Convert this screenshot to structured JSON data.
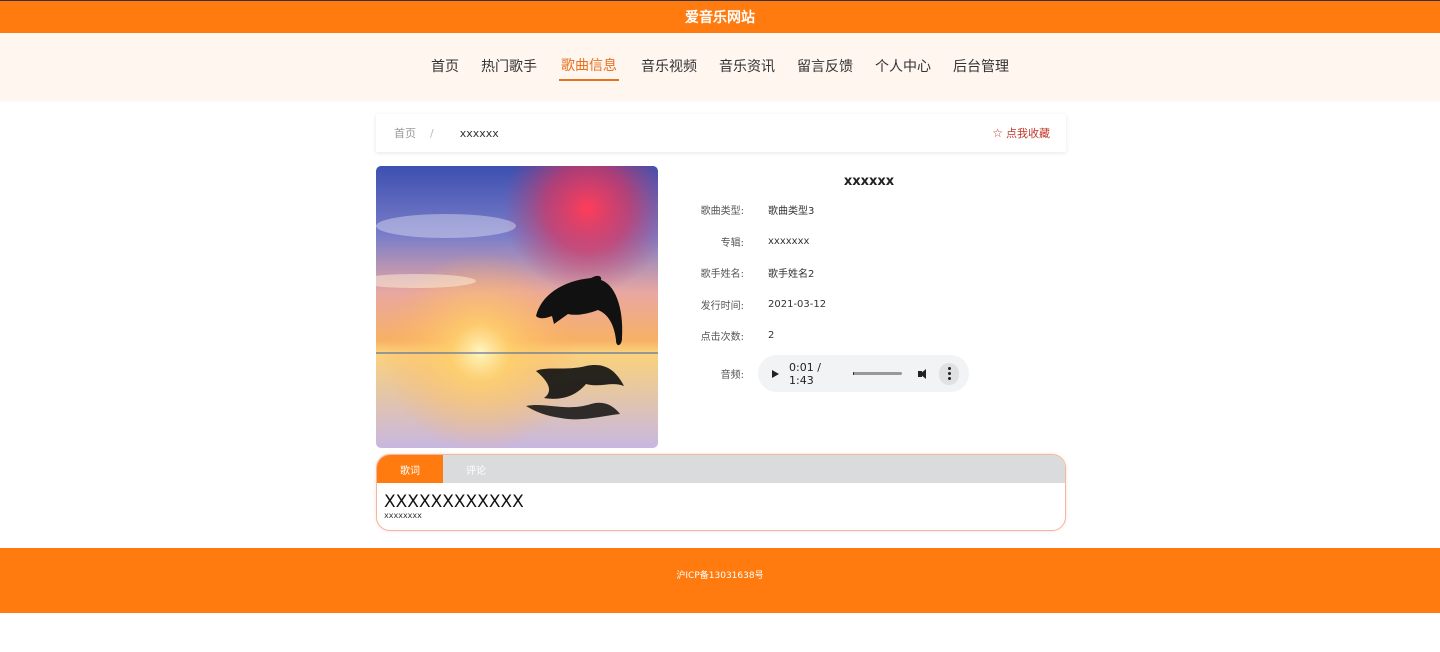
{
  "site": {
    "title": "爱音乐网站"
  },
  "nav": {
    "items": [
      {
        "label": "首页"
      },
      {
        "label": "热门歌手"
      },
      {
        "label": "歌曲信息",
        "active": true
      },
      {
        "label": "音乐视频"
      },
      {
        "label": "音乐资讯"
      },
      {
        "label": "留言反馈"
      },
      {
        "label": "个人中心"
      },
      {
        "label": "后台管理"
      }
    ]
  },
  "breadcrumb": {
    "home": "首页",
    "separator": "/",
    "current": "xxxxxx"
  },
  "favorite": {
    "label": "点我收藏",
    "icon": "star-outline-icon"
  },
  "song": {
    "title": "xxxxxx",
    "fields": [
      {
        "label": "歌曲类型:",
        "value": "歌曲类型3"
      },
      {
        "label": "专辑:",
        "value": "xxxxxxx"
      },
      {
        "label": "歌手姓名:",
        "value": "歌手姓名2"
      },
      {
        "label": "发行时间:",
        "value": "2021-03-12"
      },
      {
        "label": "点击次数:",
        "value": "2"
      }
    ],
    "audio_label": "音频:",
    "audio": {
      "time": "0:01 / 1:43",
      "progress": 0.01
    }
  },
  "tabs": [
    {
      "label": "歌词",
      "active": true
    },
    {
      "label": "评论"
    }
  ],
  "lyrics": {
    "title": "XXXXXXXXXXXX",
    "body": "xxxxxxxx"
  },
  "footer": {
    "icp": "沪ICP备13031638号"
  },
  "colors": {
    "brand": "#ff7b0f",
    "nav_active": "#e8711f",
    "favorite": "#c0392b"
  }
}
